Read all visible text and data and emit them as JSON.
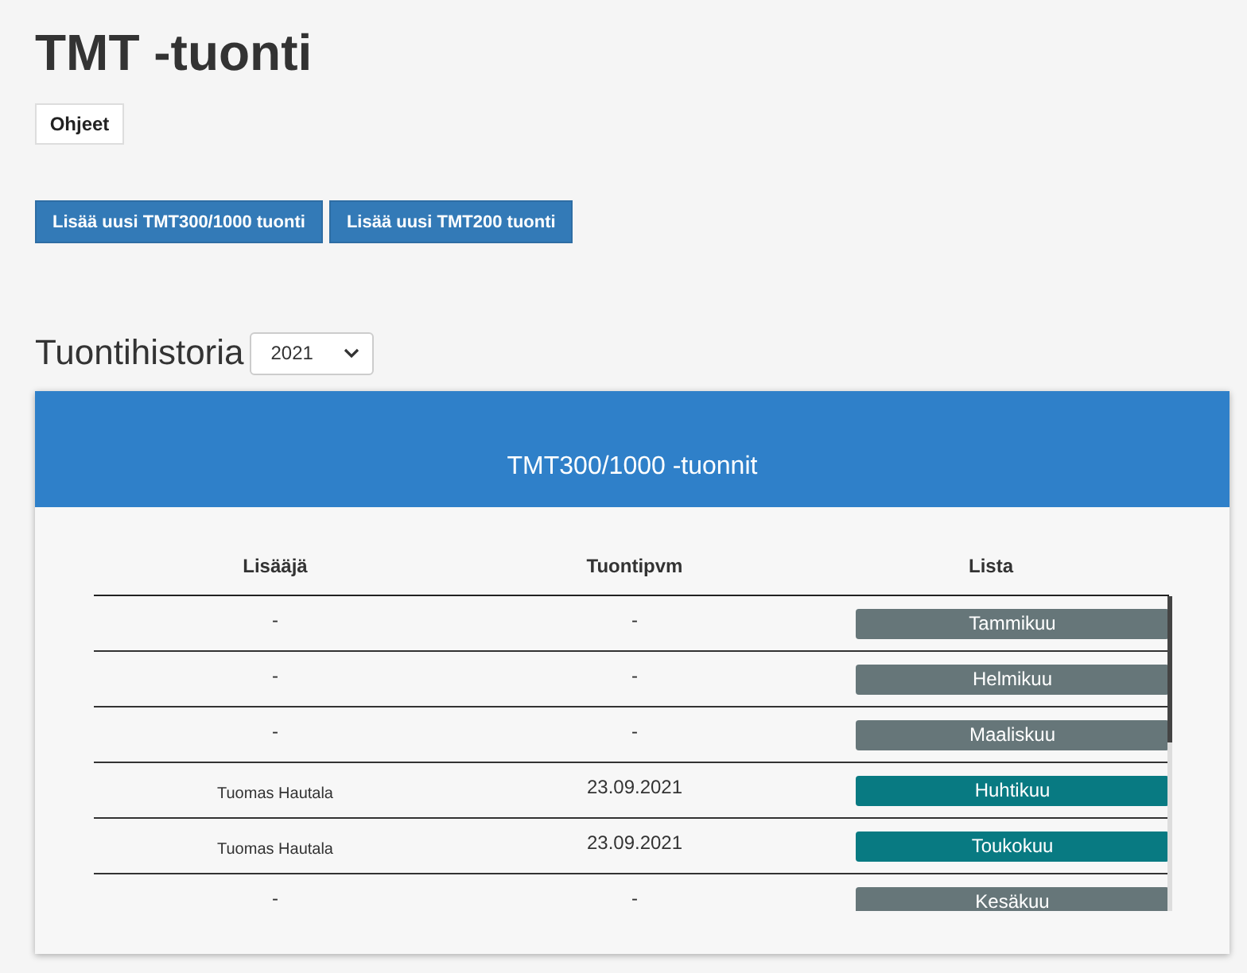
{
  "title": "TMT -tuonti",
  "help_button": "Ohjeet",
  "add_buttons": [
    "Lisää uusi TMT300/1000 tuonti",
    "Lisää uusi TMT200 tuonti"
  ],
  "history": {
    "heading": "Tuontihistoria",
    "year_select": {
      "value": "2021"
    }
  },
  "panel": {
    "title": "TMT300/1000 -tuonnit",
    "table": {
      "columns": [
        "Lisääjä",
        "Tuontipvm",
        "Lista"
      ],
      "rows": [
        {
          "adder": "-",
          "date": "-",
          "list": "Tammikuu",
          "kind": "empty"
        },
        {
          "adder": "-",
          "date": "-",
          "list": "Helmikuu",
          "kind": "empty"
        },
        {
          "adder": "-",
          "date": "-",
          "list": "Maaliskuu",
          "kind": "empty"
        },
        {
          "adder": "Tuomas Hautala",
          "date": "23.09.2021",
          "list": "Huhtikuu",
          "kind": "imported"
        },
        {
          "adder": "Tuomas Hautala",
          "date": "23.09.2021",
          "list": "Toukokuu",
          "kind": "imported"
        },
        {
          "adder": "-",
          "date": "-",
          "list": "Kesäkuu",
          "kind": "empty"
        }
      ]
    }
  }
}
